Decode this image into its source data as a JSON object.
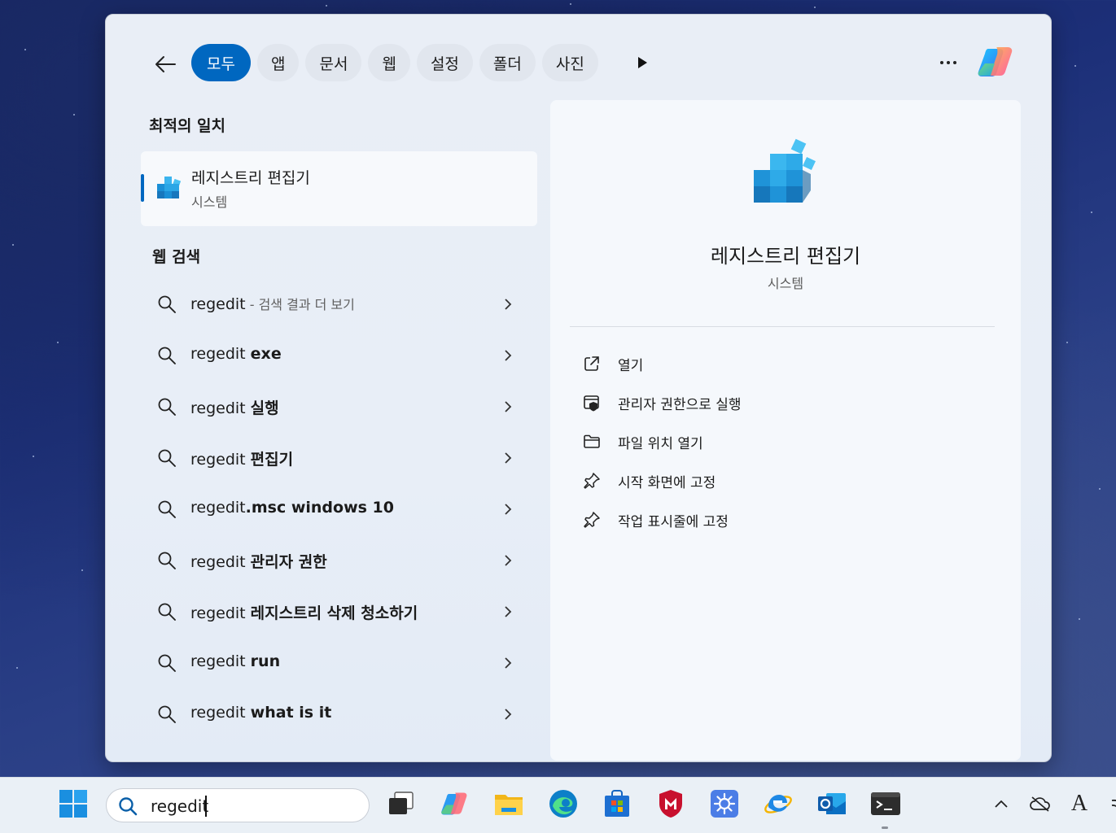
{
  "filters": {
    "tabs": [
      "모두",
      "앱",
      "문서",
      "웹",
      "설정",
      "폴더",
      "사진"
    ],
    "active_index": 0
  },
  "best_match": {
    "heading": "최적의 일치",
    "title": "레지스트리 편집기",
    "subtitle": "시스템"
  },
  "web_search": {
    "heading": "웹 검색",
    "items": [
      {
        "prefix": "regedit",
        "bold": "",
        "hint": " - 검색 결과 더 보기"
      },
      {
        "prefix": "regedit ",
        "bold": "exe",
        "hint": ""
      },
      {
        "prefix": "regedit ",
        "bold": "실행",
        "hint": ""
      },
      {
        "prefix": "regedit ",
        "bold": "편집기",
        "hint": ""
      },
      {
        "prefix": "regedit",
        "bold": ".msc windows 10",
        "hint": ""
      },
      {
        "prefix": "regedit ",
        "bold": "관리자 권한",
        "hint": ""
      },
      {
        "prefix": "regedit ",
        "bold": "레지스트리 삭제 청소하기",
        "hint": ""
      },
      {
        "prefix": "regedit ",
        "bold": "run",
        "hint": ""
      },
      {
        "prefix": "regedit ",
        "bold": "what is it",
        "hint": ""
      }
    ]
  },
  "detail": {
    "title": "레지스트리 편집기",
    "subtitle": "시스템",
    "actions": [
      {
        "icon": "open-external-icon",
        "label": "열기"
      },
      {
        "icon": "admin-shield-icon",
        "label": "관리자 권한으로 실행"
      },
      {
        "icon": "folder-icon",
        "label": "파일 위치 열기"
      },
      {
        "icon": "pin-icon",
        "label": "시작 화면에 고정"
      },
      {
        "icon": "pin-icon",
        "label": "작업 표시줄에 고정"
      }
    ]
  },
  "taskbar": {
    "search_value": "regedit",
    "apps": [
      "task-view-icon",
      "copilot-icon",
      "file-explorer-icon",
      "edge-icon",
      "microsoft-store-icon",
      "mcafee-icon",
      "settings-icon",
      "internet-explorer-icon",
      "outlook-icon",
      "terminal-icon"
    ],
    "tray": [
      "show-hidden-icons-chevron",
      "onedrive-offline-icon",
      "input-language-icon"
    ],
    "tray_ime_label": "A"
  },
  "colors": {
    "accent": "#0067c0",
    "panel_bg": "#e9eef6",
    "detail_bg": "#f5f8fc"
  }
}
